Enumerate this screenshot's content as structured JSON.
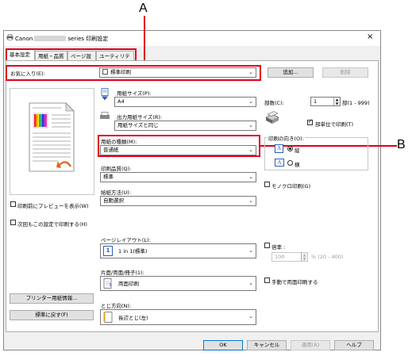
{
  "callouts": {
    "a": "A",
    "b": "B"
  },
  "window": {
    "title_prefix": "Canon",
    "title_suffix": "series 印刷設定",
    "close": "×"
  },
  "tabs": [
    "基本設定",
    "用紙・品質",
    "ページ設定",
    "ユーティリティ"
  ],
  "favorites": {
    "label": "お気に入り(E):",
    "value": "標準印刷",
    "add_button": "追加...",
    "delete_button": "削除"
  },
  "paper_size": {
    "label": "用紙サイズ(P):",
    "value": "A4"
  },
  "output_paper_size": {
    "label": "出力用紙サイズ(R):",
    "value": "用紙サイズと同じ"
  },
  "media_type": {
    "label": "用紙の種類(M):",
    "value": "普通紙"
  },
  "print_quality": {
    "label": "印刷品質(Q):",
    "value": "標準"
  },
  "paper_source": {
    "label": "給紙方法(U):",
    "value": "自動選択"
  },
  "copies": {
    "label": "部数(C):",
    "value": "1",
    "range": "部(1 - 999)",
    "collate_label": "部単位で印刷(T)",
    "collate_checked": true
  },
  "orientation": {
    "label": "印刷の向き(O):",
    "portrait": "縦",
    "landscape": "横",
    "selected": "縦",
    "portrait_glyph": "A",
    "landscape_glyph": "A"
  },
  "grayscale": {
    "label": "モノクロ印刷(G)",
    "checked": false
  },
  "preview_before_print": {
    "label": "印刷前にプレビューを表示(W)",
    "checked": false
  },
  "always_print_current": {
    "label": "次回もこの設定で印刷する(H)",
    "checked": false
  },
  "page_layout": {
    "label": "ページレイアウト(L):",
    "value": "1 in 1(標準)",
    "icon_text": "1"
  },
  "scale": {
    "label": "倍率 :",
    "value": "100",
    "range": "% (20 - 400)",
    "checked": false
  },
  "duplex": {
    "label": "片面/両面/冊子(1):",
    "value": "両面印刷"
  },
  "manual_duplex": {
    "label": "手動で両面印刷する",
    "checked": false
  },
  "binding": {
    "label": "とじ方向(N):",
    "value": "長辺とじ(左)"
  },
  "buttons": {
    "printer_paper_info": "プリンター用紙情報...",
    "defaults": "標準に戻す(F)",
    "ok": "OK",
    "cancel": "キャンセル",
    "apply": "適用(A)",
    "help": "ヘルプ"
  },
  "colors": {
    "callout_red": "#e0001b",
    "accent_blue": "#2a5fb8"
  }
}
